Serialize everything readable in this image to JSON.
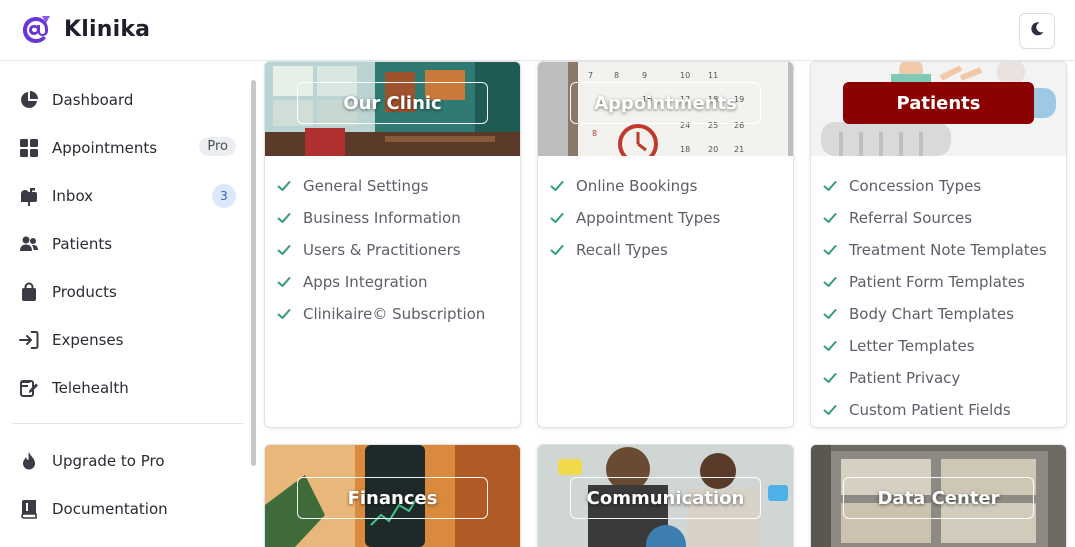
{
  "header": {
    "brand": "Klinika",
    "logo_icon": "at-sign-logo-icon",
    "theme_toggle_icon": "moon-icon",
    "brand_color": "#6a35d9"
  },
  "sidebar": {
    "items": [
      {
        "label": "Dashboard",
        "icon": "pie-chart-icon"
      },
      {
        "label": "Appointments",
        "icon": "grid-icon",
        "badge": "Pro"
      },
      {
        "label": "Inbox",
        "icon": "mailbox-icon",
        "badge": "3"
      },
      {
        "label": "Patients",
        "icon": "users-icon"
      },
      {
        "label": "Products",
        "icon": "shopping-bag-icon"
      },
      {
        "label": "Expenses",
        "icon": "sign-in-icon"
      },
      {
        "label": "Telehealth",
        "icon": "edit-note-icon"
      }
    ],
    "bottom_items": [
      {
        "label": "Upgrade to Pro",
        "icon": "flame-icon"
      },
      {
        "label": "Documentation",
        "icon": "book-icon"
      }
    ]
  },
  "cards": [
    {
      "title": "Our Clinic",
      "items": [
        "General Settings",
        "Business Information",
        "Users & Practitioners",
        "Apps Integration",
        "Clinikaire© Subscription"
      ]
    },
    {
      "title": "Appointments",
      "items": [
        "Online Bookings",
        "Appointment Types",
        "Recall Types"
      ]
    },
    {
      "title": "Patients",
      "active": true,
      "items": [
        "Concession Types",
        "Referral Sources",
        "Treatment Note Templates",
        "Patient Form Templates",
        "Body Chart Templates",
        "Letter Templates",
        "Patient Privacy",
        "Custom Patient Fields"
      ]
    }
  ],
  "bottom_cards": [
    {
      "title": "Finances"
    },
    {
      "title": "Communication"
    },
    {
      "title": "Data Center"
    }
  ],
  "colors": {
    "check": "#2e9e7e",
    "active_title_bg": "#8b0000",
    "badge_count_bg": "#dbe7fb"
  }
}
